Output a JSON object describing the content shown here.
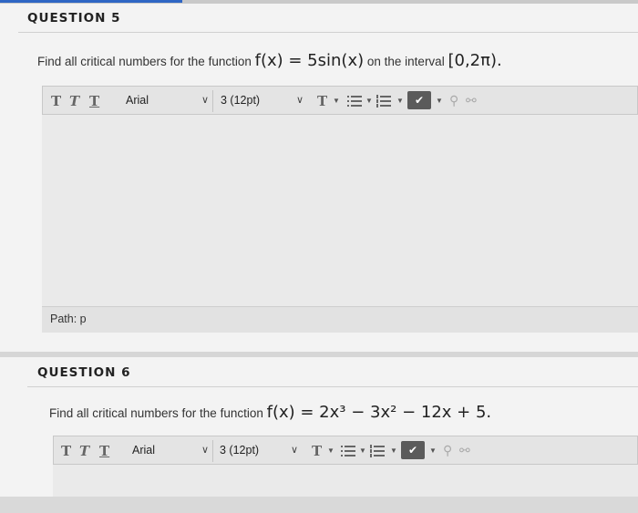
{
  "q5": {
    "title": "QUESTION 5",
    "prompt_text": "Find all critical numbers for the function",
    "function": "f(x) = 5sin(x)",
    "interval_text": "on the interval",
    "interval": "[0,2π)."
  },
  "q6": {
    "title": "QUESTION 6",
    "prompt_text": "Find all critical numbers for the function",
    "function": "f(x) = 2x³ − 3x² − 12x + 5."
  },
  "toolbar": {
    "bold": "T",
    "italic": "T",
    "underline": "T",
    "font_family": "Arial",
    "font_size": "3 (12pt)",
    "text_color": "T"
  },
  "editor": {
    "path_label": "Path: p"
  },
  "icons": {
    "chevron": "chevron-down-icon",
    "bullet_list": "bullet-list-icon",
    "numbered_list": "numbered-list-icon",
    "spellcheck": "spellcheck-icon",
    "link": "link-icon",
    "unlink": "unlink-icon"
  }
}
